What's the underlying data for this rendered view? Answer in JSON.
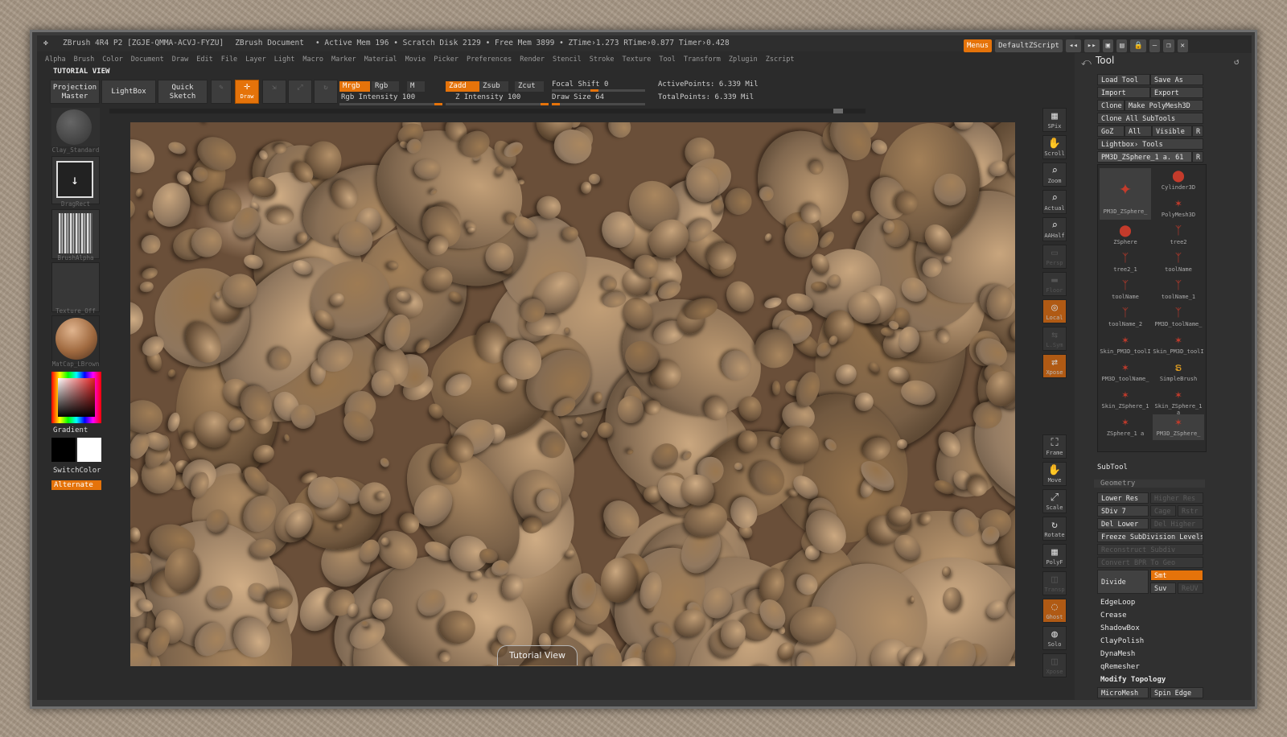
{
  "title_bar": {
    "app": "ZBrush 4R4 P2 [ZGJE-QMMA-ACVJ-FYZU]",
    "document": "ZBrush Document",
    "stats": "• Active Mem 196 • Scratch Disk 2129 • Free Mem 3899 • ZTime›1.273 RTime›0.877 Timer›0.428"
  },
  "top_right": {
    "menus": "Menus",
    "script": "DefaultZScript"
  },
  "menu": [
    "Alpha",
    "Brush",
    "Color",
    "Document",
    "Draw",
    "Edit",
    "File",
    "Layer",
    "Light",
    "Macro",
    "Marker",
    "Material",
    "Movie",
    "Picker",
    "Preferences",
    "Render",
    "Stencil",
    "Stroke",
    "Texture",
    "Tool",
    "Transform",
    "Zplugin",
    "Zscript"
  ],
  "tutorial_label": "TUTORIAL VIEW",
  "toolbar": {
    "projection_master": "Projection Master",
    "lightbox": "LightBox",
    "quick_sketch": "Quick Sketch",
    "edit": "Edit",
    "draw": "Draw",
    "move": "Move",
    "scale": "Scale",
    "rotate": "Rotate",
    "mrgb": "Mrgb",
    "rgb": "Rgb",
    "m": "M",
    "zadd": "Zadd",
    "zsub": "Zsub",
    "zcut": "Zcut",
    "rgb_intensity": "Rgb Intensity 100",
    "z_intensity": "Z Intensity 100",
    "focal_shift": "Focal Shift 0",
    "draw_size": "Draw Size 64",
    "active_points": "ActivePoints: 6.339 Mil",
    "total_points": "TotalPoints: 6.339 Mil",
    "rgb_intensity_value": 100,
    "z_intensity_value": 100,
    "focal_shift_value": 0,
    "draw_size_value": 64
  },
  "left_shelf": {
    "brush_caption": "Clay_Standard",
    "stroke_caption": "DragRect",
    "alpha_caption": "BrushAlpha",
    "texture_caption": "Texture_Off",
    "material_caption": "MatCap_LBrown",
    "gradient": "Gradient",
    "switch_color": "SwitchColor",
    "alternate": "Alternate"
  },
  "right_tools": [
    "SPix",
    "Scroll",
    "Zoom",
    "Actual",
    "AAHalf",
    "Persp",
    "Floor",
    "Local",
    "L.Sym",
    "Xpose",
    "Frame",
    "Move",
    "Scale",
    "Rotate",
    "PolyF",
    "Transp",
    "Ghost",
    "Solo",
    "Xpose"
  ],
  "tool_panel": {
    "title": "Tool",
    "load_tool": "Load Tool",
    "save_as": "Save As",
    "import": "Import",
    "export": "Export",
    "clone": "Clone",
    "make_polymesh": "Make PolyMesh3D",
    "clone_all": "Clone All SubTools",
    "goz": "GoZ",
    "all": "All",
    "visible": "Visible",
    "r": "R",
    "lightbox_tools": "Lightbox› Tools",
    "current_tool": "PM3D_ZSphere_1 a. 61",
    "tools": [
      {
        "name": "PM3D_ZSphere_"
      },
      {
        "name": "Cylinder3D"
      },
      {
        "name": ""
      },
      {
        "name": "PolyMesh3D"
      },
      {
        "name": "ZSphere"
      },
      {
        "name": "tree2"
      },
      {
        "name": "tree2_1"
      },
      {
        "name": "toolName"
      },
      {
        "name": "toolName"
      },
      {
        "name": "toolName_1"
      },
      {
        "name": "toolName_2"
      },
      {
        "name": "PM3D_toolName_"
      },
      {
        "name": "Skin_PM3D_toolI"
      },
      {
        "name": "Skin_PM3D_toolI"
      },
      {
        "name": "PM3D_toolName_"
      },
      {
        "name": "SimpleBrush"
      },
      {
        "name": "Skin_ZSphere_1"
      },
      {
        "name": "Skin_ZSphere_1 a"
      },
      {
        "name": "ZSphere_1 a"
      },
      {
        "name": "PM3D_ZSphere_"
      }
    ],
    "subtool": "SubTool",
    "geometry": "Geometry",
    "lower_res": "Lower Res",
    "higher_res": "Higher Res",
    "sdiv": "SDiv 7",
    "cage": "Cage",
    "rstr": "Rstr",
    "del_lower": "Del Lower",
    "del_higher": "Del Higher",
    "freeze": "Freeze SubDivision Levels",
    "reconstruct": "Reconstruct Subdiv",
    "convert_bpr": "Convert BPR To Geo",
    "divide": "Divide",
    "smt": "Smt",
    "suv": "Suv",
    "reuv": "ReUV",
    "edgeloop": "EdgeLoop",
    "crease": "Crease",
    "shadowbox": "ShadowBox",
    "claypolish": "ClayPolish",
    "dynamesh": "DynaMesh",
    "qremesher": "qRemesher",
    "modify_topology": "Modify Topology",
    "micromesh": "MicroMesh",
    "spin_edge": "Spin Edge"
  },
  "canvas": {
    "overlay_label": "Tutorial View"
  }
}
